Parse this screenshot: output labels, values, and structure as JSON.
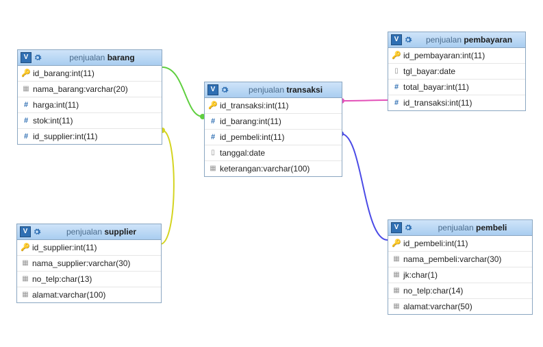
{
  "db": "penjualan",
  "tables": {
    "barang": {
      "name": "barang",
      "cols": [
        {
          "icon": "key",
          "name": "id_barang",
          "type": "int(11)"
        },
        {
          "icon": "text",
          "name": "nama_barang",
          "type": "varchar(20)"
        },
        {
          "icon": "num",
          "name": "harga",
          "type": "int(11)"
        },
        {
          "icon": "num",
          "name": "stok",
          "type": "int(11)"
        },
        {
          "icon": "num",
          "name": "id_supplier",
          "type": "int(11)"
        }
      ]
    },
    "transaksi": {
      "name": "transaksi",
      "cols": [
        {
          "icon": "key",
          "name": "id_transaksi",
          "type": "int(11)"
        },
        {
          "icon": "num",
          "name": "id_barang",
          "type": "int(11)"
        },
        {
          "icon": "num",
          "name": "id_pembeli",
          "type": "int(11)"
        },
        {
          "icon": "date",
          "name": "tanggal",
          "type": "date"
        },
        {
          "icon": "text",
          "name": "keterangan",
          "type": "varchar(100)"
        }
      ]
    },
    "pembayaran": {
      "name": "pembayaran",
      "cols": [
        {
          "icon": "key",
          "name": "id_pembayaran",
          "type": "int(11)"
        },
        {
          "icon": "date",
          "name": "tgl_bayar",
          "type": "date"
        },
        {
          "icon": "num",
          "name": "total_bayar",
          "type": "int(11)"
        },
        {
          "icon": "num",
          "name": "id_transaksi",
          "type": "int(11)"
        }
      ]
    },
    "supplier": {
      "name": "supplier",
      "cols": [
        {
          "icon": "key",
          "name": "id_supplier",
          "type": "int(11)"
        },
        {
          "icon": "text",
          "name": "nama_supplier",
          "type": "varchar(30)"
        },
        {
          "icon": "text",
          "name": "no_telp",
          "type": "char(13)"
        },
        {
          "icon": "text",
          "name": "alamat",
          "type": "varchar(100)"
        }
      ]
    },
    "pembeli": {
      "name": "pembeli",
      "cols": [
        {
          "icon": "key",
          "name": "id_pembeli",
          "type": "int(11)"
        },
        {
          "icon": "text",
          "name": "nama_pembeli",
          "type": "varchar(30)"
        },
        {
          "icon": "text",
          "name": "jk",
          "type": "char(1)"
        },
        {
          "icon": "text",
          "name": "no_telp",
          "type": "char(14)"
        },
        {
          "icon": "text",
          "name": "alamat",
          "type": "varchar(50)"
        }
      ]
    }
  },
  "relations": [
    {
      "from": "barang.id_barang",
      "to": "transaksi.id_barang",
      "color": "#5fcf3f"
    },
    {
      "from": "supplier.id_supplier",
      "to": "barang.id_supplier",
      "color": "#d4d420"
    },
    {
      "from": "pembayaran.id_transaksi",
      "to": "transaksi.id_transaksi",
      "color": "#e350b8"
    },
    {
      "from": "pembeli.id_pembeli",
      "to": "transaksi.id_pembeli",
      "color": "#4a4ae6"
    }
  ],
  "chart_data": {
    "type": "table",
    "title": "penjualan schema ER diagram",
    "entities": [
      "barang",
      "transaksi",
      "pembayaran",
      "supplier",
      "pembeli"
    ],
    "relationships": [
      [
        "barang.id_barang",
        "transaksi.id_barang"
      ],
      [
        "supplier.id_supplier",
        "barang.id_supplier"
      ],
      [
        "pembayaran.id_transaksi",
        "transaksi.id_transaksi"
      ],
      [
        "pembeli.id_pembeli",
        "transaksi.id_pembeli"
      ]
    ]
  }
}
